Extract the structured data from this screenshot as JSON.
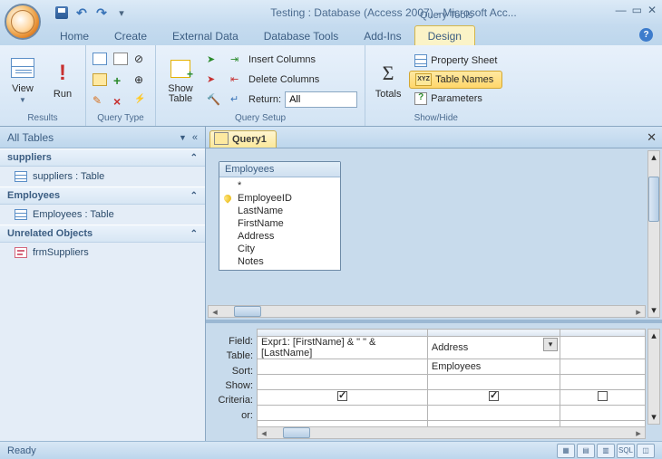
{
  "title": "Testing : Database (Access 2007) - Microsoft Acc...",
  "context_tab_group": "Query Tools",
  "tabs": [
    "Home",
    "Create",
    "External Data",
    "Database Tools",
    "Add-Ins",
    "Design"
  ],
  "active_tab": "Design",
  "ribbon": {
    "results": {
      "label": "Results",
      "view": "View",
      "run": "Run"
    },
    "query_type": {
      "label": "Query Type"
    },
    "query_setup": {
      "label": "Query Setup",
      "show_table": "Show\nTable",
      "insert_cols": "Insert Columns",
      "delete_cols": "Delete Columns",
      "return": "Return:",
      "return_value": "All"
    },
    "totals": {
      "label": "Totals"
    },
    "show_hide": {
      "label": "Show/Hide",
      "property_sheet": "Property Sheet",
      "table_names": "Table Names",
      "parameters": "Parameters"
    }
  },
  "nav": {
    "header": "All Tables",
    "groups": [
      {
        "name": "suppliers",
        "items": [
          {
            "label": "suppliers : Table",
            "icon": "table"
          }
        ]
      },
      {
        "name": "Employees",
        "items": [
          {
            "label": "Employees : Table",
            "icon": "table"
          }
        ]
      },
      {
        "name": "Unrelated Objects",
        "items": [
          {
            "label": "frmSuppliers",
            "icon": "form"
          }
        ]
      }
    ]
  },
  "doc_tab": "Query1",
  "field_box": {
    "title": "Employees",
    "fields": [
      {
        "name": "*",
        "pk": false
      },
      {
        "name": "EmployeeID",
        "pk": true
      },
      {
        "name": "LastName",
        "pk": false
      },
      {
        "name": "FirstName",
        "pk": false
      },
      {
        "name": "Address",
        "pk": false
      },
      {
        "name": "City",
        "pk": false
      },
      {
        "name": "Notes",
        "pk": false
      }
    ]
  },
  "grid": {
    "row_labels": [
      "Field:",
      "Table:",
      "Sort:",
      "Show:",
      "Criteria:",
      "or:"
    ],
    "cols": [
      {
        "field": "Expr1: [FirstName] & \" \" & [LastName]",
        "table": "",
        "show": true
      },
      {
        "field": "Address",
        "table": "Employees",
        "show": true,
        "selected": true
      },
      {
        "field": "",
        "table": "",
        "show": false
      }
    ]
  },
  "status": "Ready",
  "view_buttons": [
    "▦",
    "▤",
    "▥",
    "SQL",
    "◫"
  ]
}
